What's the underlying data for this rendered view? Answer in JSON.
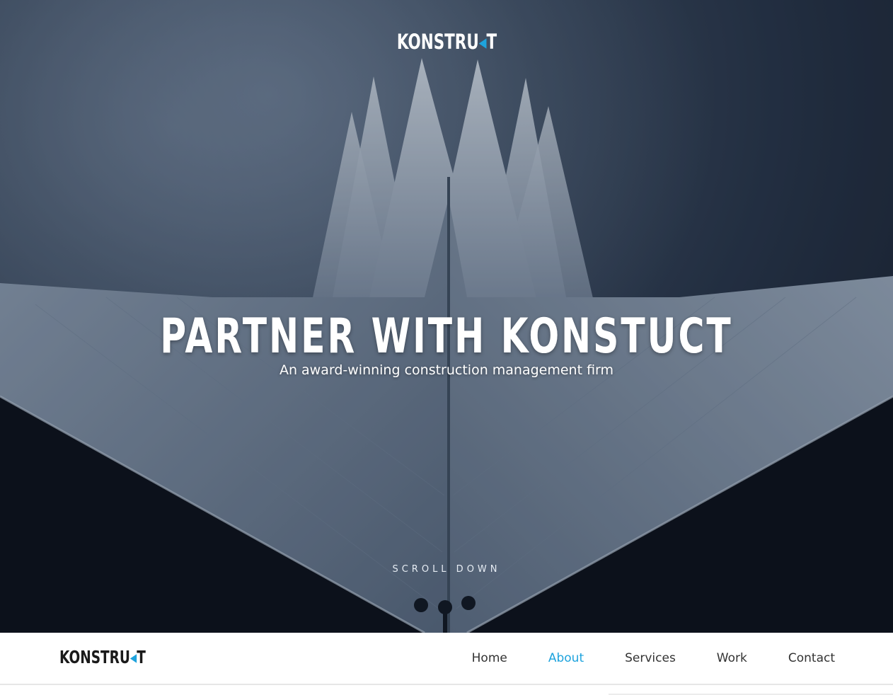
{
  "brand": {
    "logo_main": "KONSTRU",
    "logo_mark": "◂",
    "logo_end": "T",
    "accent_color": "#1ea3dd"
  },
  "hero": {
    "headline": "PARTNER WITH KONSTUCT",
    "subtitle": "An award-winning construction management firm",
    "scroll_label": "SCROLL DOWN"
  },
  "nav": {
    "items": [
      {
        "label": "Home",
        "active": false
      },
      {
        "label": "About",
        "active": true
      },
      {
        "label": "Services",
        "active": false
      },
      {
        "label": "Work",
        "active": false
      },
      {
        "label": "Contact",
        "active": false
      }
    ],
    "active_color": "#1ea3dd",
    "text_color": "#333333"
  }
}
